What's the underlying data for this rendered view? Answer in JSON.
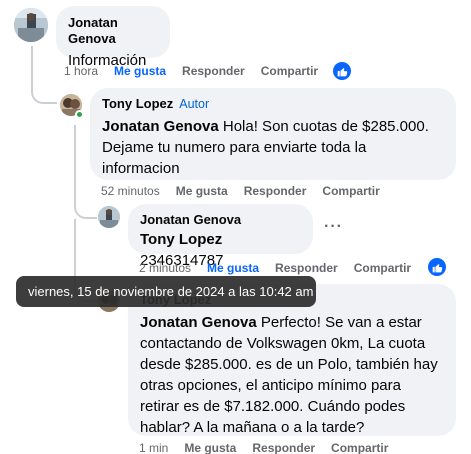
{
  "comments": [
    {
      "author": "Jonatan Genova",
      "badge": "",
      "text": "Información",
      "time": "1 hora",
      "like_label": "Me gusta",
      "reply_label": "Responder",
      "share_label": "Compartir",
      "liked": true,
      "has_reaction": true
    },
    {
      "author": "Tony Lopez",
      "badge": "Autor",
      "mention": "Jonatan Genova",
      "text_lines": [
        "Hola! Son cuotas de $285.000.",
        "Dejame tu numero para enviarte toda la",
        "informacion"
      ],
      "time": "52 minutos",
      "like_label": "Me gusta",
      "reply_label": "Responder",
      "share_label": "Compartir",
      "liked": false
    },
    {
      "author": "Jonatan Genova",
      "mention": "Tony Lopez",
      "text": "2346314787",
      "time": "2 minutos",
      "like_label": "Me gusta",
      "reply_label": "Responder",
      "share_label": "Compartir",
      "liked": true,
      "has_reaction": true
    },
    {
      "author": "Tony Lopez",
      "mention": "Jonatan Genova",
      "text_lines": [
        "Perfecto! Se van a estar",
        "contactando de Volkswagen 0km, La cuota",
        "desde $285.000. es de un Polo, también hay",
        "otras opciones, el anticipo mínimo para",
        "retirar es de $7.182.000. Cuándo podes",
        "hablar? A la mañana o a la tarde?"
      ],
      "time": "1 min",
      "like_label": "Me gusta",
      "reply_label": "Responder",
      "share_label": "Compartir",
      "liked": false
    }
  ],
  "tooltip": "viernes, 15 de noviembre de 2024 a las 10:42 am",
  "more_options": "···",
  "colors": {
    "bubble": "#f0f2f5",
    "link_blue": "#0866ff",
    "meta_gray": "#65676b",
    "online_green": "#31a24c"
  },
  "icons": [
    "like-thumb-icon",
    "online-status-icon",
    "more-options-icon"
  ]
}
